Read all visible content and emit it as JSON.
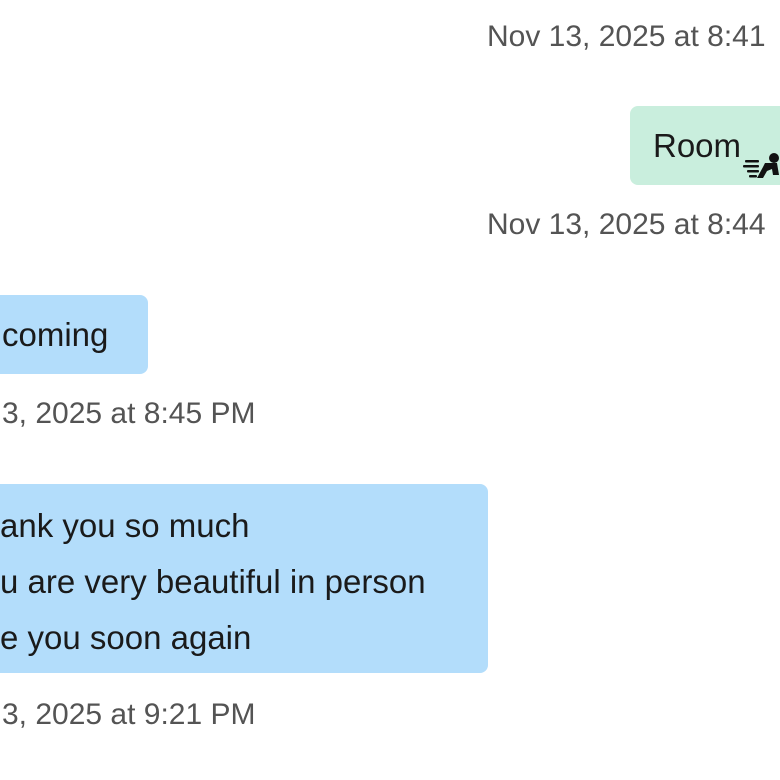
{
  "thread": {
    "messages": [
      {
        "type": "timestamp",
        "text": "Nov 13, 2025 at 8:41"
      },
      {
        "type": "outgoing",
        "text": "Room",
        "icon": "running-figure-icon"
      },
      {
        "type": "timestamp",
        "text": "Nov 13, 2025 at 8:44"
      },
      {
        "type": "incoming",
        "text": "coming"
      },
      {
        "type": "timestamp",
        "text": "3, 2025 at 8:45 PM"
      },
      {
        "type": "incoming",
        "lines": [
          "ank you so much",
          "u are very beautiful in person",
          "e you soon again"
        ]
      },
      {
        "type": "timestamp",
        "text": "3, 2025 at 9:21 PM"
      }
    ]
  },
  "colors": {
    "outgoing_bubble": "#c9eedd",
    "incoming_bubble": "#b3ddfb",
    "timestamp_text": "#545454",
    "message_text": "#1a1a1a",
    "background": "#ffffff"
  }
}
